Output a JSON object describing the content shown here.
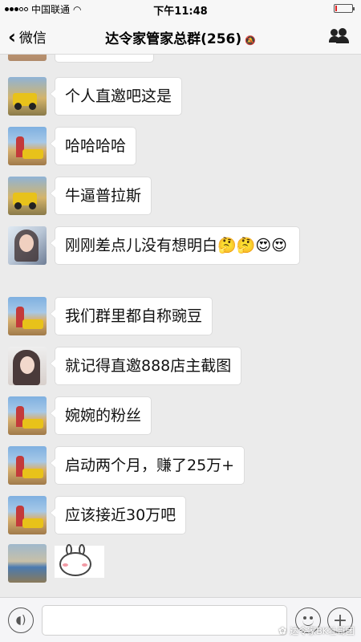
{
  "status_bar": {
    "carrier": "中国联通",
    "time": "下午11:48",
    "battery_level": 0.1
  },
  "nav": {
    "back_label": "微信",
    "title": "达令家管家总群(256)",
    "mute_icon": "mute-bell-icon",
    "members_icon": "group-members-icon"
  },
  "messages": [
    {
      "avatar": "jeep",
      "text": "个人直邀吧这是"
    },
    {
      "avatar": "desert",
      "text": "哈哈哈哈"
    },
    {
      "avatar": "jeep",
      "text": "牛逼普拉斯"
    },
    {
      "avatar": "girl",
      "text": "刚刚差点儿没有想明白🤔🤔😍😍"
    },
    {
      "avatar": "desert",
      "text": "我们群里都自称豌豆"
    },
    {
      "avatar": "girl2",
      "text": "就记得直邀888店主截图"
    },
    {
      "avatar": "desert",
      "text": "婉婉的粉丝"
    },
    {
      "avatar": "desert",
      "text": "启动两个月，赚了25万+"
    },
    {
      "avatar": "desert",
      "text": "应该接近30万吧"
    },
    {
      "avatar": "lake",
      "text": "",
      "sticker": "blushing-rabbit-sticker"
    }
  ],
  "input_bar": {
    "voice_icon": "voice-icon",
    "emoji_icon": "emoji-icon",
    "plus_icon": "plus-icon"
  },
  "watermark": "达令家BK壮哥团"
}
